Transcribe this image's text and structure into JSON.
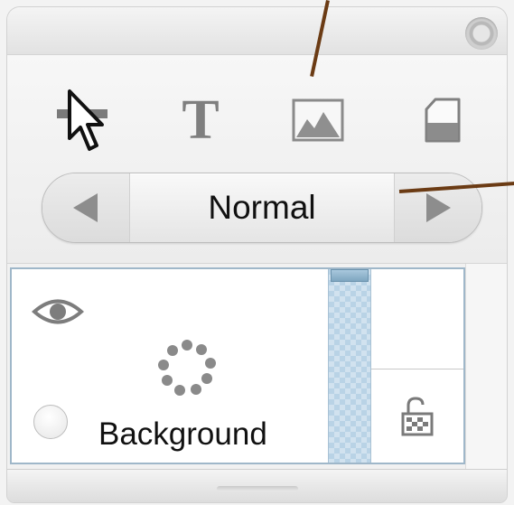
{
  "tools": {
    "select": {
      "icon": "arrow-pointer-icon"
    },
    "text": {
      "icon": "text-tool-icon",
      "label": "T"
    },
    "image": {
      "icon": "image-icon"
    },
    "shape": {
      "icon": "half-filled-rectangle-icon"
    }
  },
  "blend_mode": {
    "value": "Normal",
    "prev_icon": "triangle-left-icon",
    "next_icon": "triangle-right-icon"
  },
  "layers": [
    {
      "name": "Background",
      "visibility_icon": "eye-icon",
      "thumbnail_icon": "dotted-circle-spinner-icon",
      "lock_icon": "unlocked-padlock-icon"
    }
  ],
  "colors": {
    "callout": "#6b3b14",
    "selection_border": "#9fb7c9",
    "scroll_track": "#b9d3e6"
  }
}
